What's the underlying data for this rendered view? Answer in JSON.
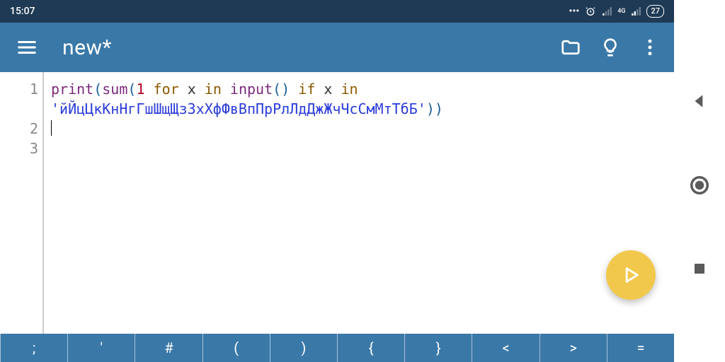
{
  "status": {
    "time": "15:07",
    "network_label": "4G",
    "battery": "27"
  },
  "toolbar": {
    "title": "new*",
    "menu_icon": "menu",
    "open_icon": "folder-open",
    "hint_icon": "lightbulb",
    "overflow_icon": "more-vert"
  },
  "editor": {
    "lines": [
      "1",
      "2",
      "3"
    ],
    "code": {
      "l1_print": "print",
      "l1_sum": "sum",
      "l1_open1": "(",
      "l1_open2": "(",
      "l1_one": "1",
      "l1_for": " for ",
      "l1_x1": "x",
      "l1_in1": " in ",
      "l1_input": "input",
      "l1_open3": "(",
      "l1_close3": ")",
      "l1_if": " if ",
      "l1_x2": "x",
      "l1_in2": " in ",
      "l1_string": "'йЙцЦкКнНгГшШщЩзЗхХфФвВпПрРлЛдДжЖчЧсСмМтТбБ'",
      "l1_close2": ")",
      "l1_close1": ")"
    }
  },
  "fab": {
    "icon": "play"
  },
  "symbol_bar": [
    ";",
    "'",
    "#",
    "(",
    ")",
    "{",
    "}",
    "<",
    ">",
    "="
  ],
  "nav": {
    "back": "back-triangle",
    "home": "home-circle",
    "recents": "recents-square"
  }
}
